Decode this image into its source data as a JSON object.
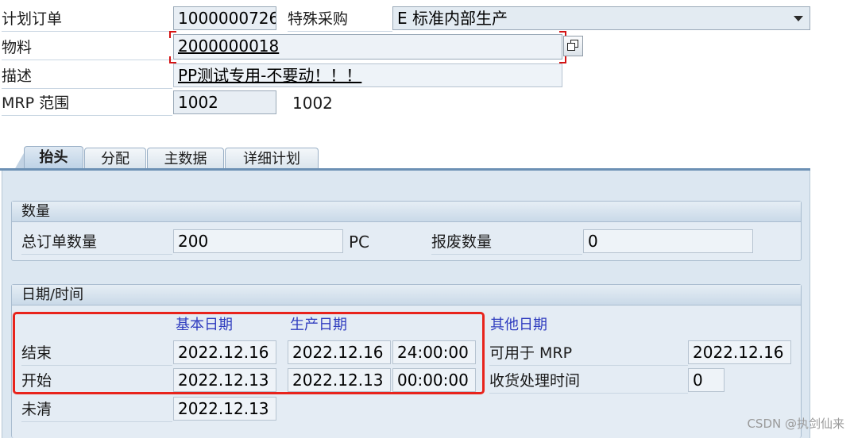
{
  "header": {
    "planned_order_label": "计划订单",
    "planned_order_value": "1000000726",
    "special_procurement_label": "特殊采购",
    "special_procurement_value": "E 标准内部生产",
    "material_label": "物料",
    "material_value": "2000000018",
    "description_label": "描述",
    "description_value": "PP测试专用-不要动！！！",
    "mrp_area_label": "MRP 范围",
    "mrp_area_value": "1002",
    "mrp_area_text": "1002"
  },
  "tabs": [
    "抬头",
    "分配",
    "主数据",
    "详细计划"
  ],
  "quantity_group": {
    "title": "数量",
    "total_qty_label": "总订单数量",
    "total_qty_value": "200",
    "unit": "PC",
    "scrap_label": "报废数量",
    "scrap_value": "0"
  },
  "dates_group": {
    "title": "日期/时间",
    "basic_dates_header": "基本日期",
    "production_dates_header": "生产日期",
    "other_dates_header": "其他日期",
    "end_label": "结束",
    "end_basic": "2022.12.16",
    "end_prod": "2022.12.16",
    "end_time": "24:00:00",
    "start_label": "开始",
    "start_basic": "2022.12.13",
    "start_prod": "2022.12.13",
    "start_time": "00:00:00",
    "open_label": "未清",
    "open_basic": "2022.12.13",
    "available_mrp_label": "可用于 MRP",
    "available_mrp_value": "2022.12.16",
    "gr_time_label": "收货处理时间",
    "gr_time_value": "0"
  },
  "watermark": "CSDN @执剑仙来",
  "colors": {
    "highlight_box": "#e8231c",
    "column_header": "#2f3cbf",
    "panel": "#dce7f1"
  }
}
